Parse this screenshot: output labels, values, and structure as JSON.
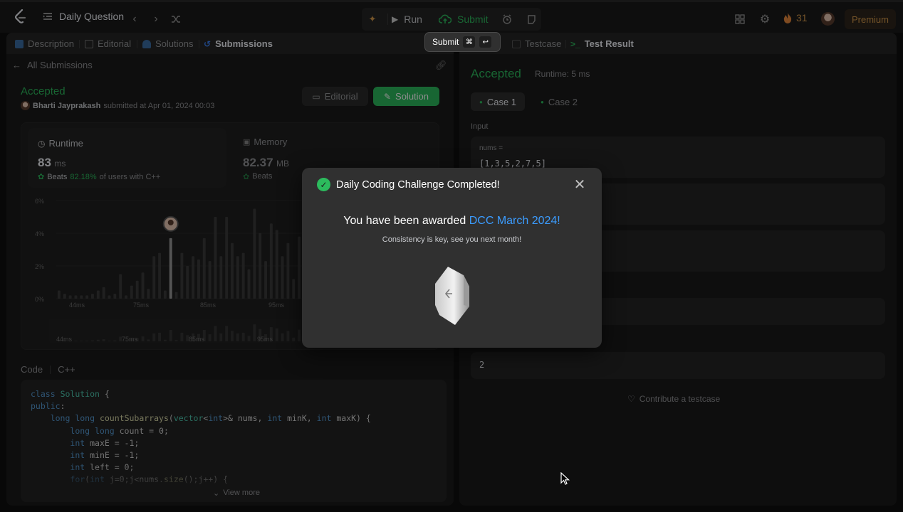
{
  "topbar": {
    "title": "Daily Question",
    "run_label": "Run",
    "submit_label": "Submit",
    "streak": "31",
    "premium_label": "Premium"
  },
  "tooltip": {
    "label": "Submit",
    "key1": "⌘",
    "key2": "↩"
  },
  "left_tabs": [
    "Description",
    "Editorial",
    "Solutions",
    "Submissions"
  ],
  "right_tabs": [
    "Testcase",
    "Test Result"
  ],
  "submission": {
    "back_label": "All Submissions",
    "status": "Accepted",
    "user": "Bharti Jayprakash",
    "submitted_text": "submitted at Apr 01, 2024 00:03",
    "editorial_btn": "Editorial",
    "solution_btn": "Solution",
    "runtime_title": "Runtime",
    "runtime_value": "83",
    "runtime_unit": "ms",
    "runtime_beats_pre": "Beats",
    "runtime_beats_pct": "82.18%",
    "runtime_beats_post": "of users with C++",
    "memory_title": "Memory",
    "memory_value": "82.37",
    "memory_unit": "MB",
    "memory_beats_pre": "Beats"
  },
  "chart_data": {
    "type": "bar",
    "y_ticks": [
      "6%",
      "4%",
      "2%",
      "0%"
    ],
    "x_ticks": [
      "44ms",
      "75ms",
      "85ms",
      "95ms"
    ],
    "mini_x_ticks": [
      "44ms",
      "75ms",
      "85ms",
      "95ms"
    ],
    "ylim": [
      0,
      6
    ],
    "values": [
      0.5,
      0.3,
      0.2,
      0.2,
      0.2,
      0.2,
      0.3,
      0.5,
      0.7,
      0.2,
      0.3,
      1.5,
      0.2,
      0.8,
      1.1,
      1.6,
      0.6,
      2.6,
      2.8,
      0.5,
      3.7,
      0.4,
      2.8,
      2.0,
      2.6,
      2.4,
      3.7,
      2.3,
      5.0,
      2.6,
      5.0,
      3.4,
      2.6,
      2.8,
      1.8,
      5.5,
      4.0,
      2.3,
      4.6,
      4.2,
      2.6,
      3.4,
      1.2,
      3.8
    ],
    "highlight_index": 20
  },
  "code": {
    "label": "Code",
    "lang": "C++",
    "view_more": "View more"
  },
  "result": {
    "status": "Accepted",
    "runtime": "Runtime: 5 ms",
    "case1": "Case 1",
    "case2": "Case 2",
    "input_label": "Input",
    "nums_label": "nums =",
    "nums_value": "[1,3,5,2,7,5]",
    "output_value": "2",
    "contribute": "Contribute a testcase"
  },
  "modal": {
    "title": "Daily Coding Challenge Completed!",
    "award_prefix": "You have been awarded ",
    "award_name": "DCC March 2024!",
    "subtitle": "Consistency is key, see you next month!"
  }
}
